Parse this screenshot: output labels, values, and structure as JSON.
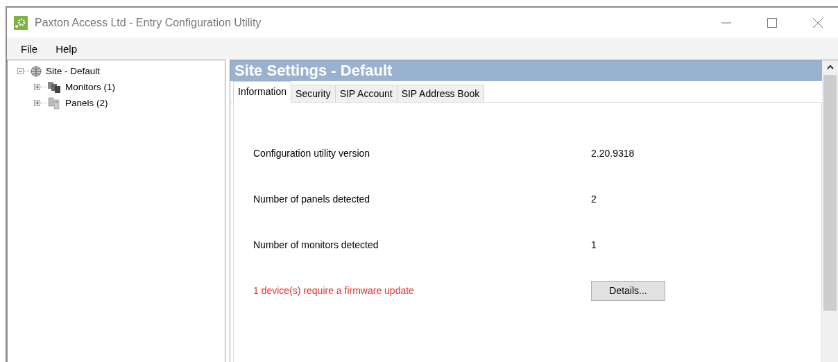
{
  "window": {
    "title": "Paxton Access Ltd - Entry Configuration Utility"
  },
  "menu": [
    {
      "label": "File"
    },
    {
      "label": "Help"
    }
  ],
  "tree": [
    {
      "label": "Site - Default",
      "kind": "site",
      "expanded": true,
      "children": [
        {
          "label": "Monitors (1)",
          "kind": "monitors",
          "expanded": false
        },
        {
          "label": "Panels (2)",
          "kind": "panels",
          "expanded": false
        }
      ]
    }
  ],
  "panel": {
    "title": "Site Settings - Default"
  },
  "tabs": [
    {
      "label": "Information",
      "selected": true
    },
    {
      "label": "Security",
      "selected": false
    },
    {
      "label": "SIP Account",
      "selected": false
    },
    {
      "label": "SIP Address Book",
      "selected": false
    }
  ],
  "info_rows": [
    {
      "kind": "value",
      "label": "Configuration utility version",
      "value": "2.20.9318"
    },
    {
      "kind": "value",
      "label": "Number of panels detected",
      "value": "2"
    },
    {
      "kind": "value",
      "label": "Number of monitors detected",
      "value": "1"
    },
    {
      "kind": "action",
      "label": "1 device(s) require a firmware update",
      "button": "Details..."
    }
  ]
}
